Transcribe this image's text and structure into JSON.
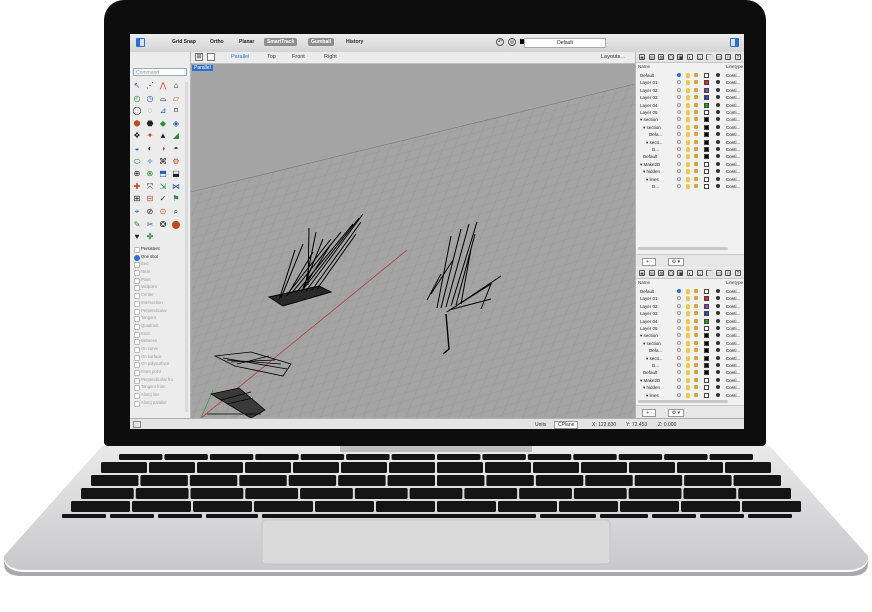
{
  "toolbar": {
    "items": [
      "Grid Snap",
      "Ortho",
      "Planar",
      "SmartTrack",
      "Gumball",
      "History"
    ],
    "active": [
      "SmartTrack",
      "Gumball"
    ],
    "layer_value": "Default"
  },
  "command": {
    "placeholder": "Command"
  },
  "viewport_tabs": {
    "items": [
      "Parallel",
      "Top",
      "Front",
      "Right"
    ],
    "active": "Parallel",
    "layouts": "Layouts..."
  },
  "viewport": {
    "label": "Parallel"
  },
  "snaps": {
    "persistent": "Persistent",
    "one_shot": "One shot",
    "items": [
      "End",
      "Near",
      "Point",
      "Midpoint",
      "Center",
      "Intersection",
      "Perpendicular",
      "Tangent",
      "Quadrant",
      "Knot",
      "Between",
      "On curve",
      "On surface",
      "On polysurface",
      "From point",
      "Perpendicular fro",
      "Tangent from",
      "Along line",
      "Along parallel"
    ]
  },
  "layers": {
    "header_name": "Name",
    "header_linetype": "Linetype",
    "linetype_value": "Conti...",
    "rows": [
      {
        "name": "Default",
        "indent": 0,
        "current": true,
        "color": "#ffffff"
      },
      {
        "name": "Layer 01",
        "indent": 0,
        "color": "#e0262b"
      },
      {
        "name": "Layer 02",
        "indent": 0,
        "color": "#8a3fc2"
      },
      {
        "name": "Layer 03",
        "indent": 0,
        "color": "#2846c9"
      },
      {
        "name": "Layer 04",
        "indent": 0,
        "color": "#1f9e2c"
      },
      {
        "name": "Layer 05",
        "indent": 0,
        "color": "#ffffff"
      },
      {
        "name": "▾ section",
        "indent": 0,
        "color": "#000000"
      },
      {
        "name": "▾ section",
        "indent": 1,
        "color": "#000000"
      },
      {
        "name": "Defa...",
        "indent": 3,
        "color": "#000000"
      },
      {
        "name": "▾ secti...",
        "indent": 2,
        "color": "#000000"
      },
      {
        "name": "D...",
        "indent": 4,
        "color": "#000000"
      },
      {
        "name": "Default",
        "indent": 1,
        "color": "#000000"
      },
      {
        "name": "▾ Make2D",
        "indent": 0,
        "color": "#ffffff"
      },
      {
        "name": "▾ hidden",
        "indent": 1,
        "color": "#ffffff"
      },
      {
        "name": "▾ lines",
        "indent": 2,
        "color": "#ffffff"
      },
      {
        "name": "D...",
        "indent": 4,
        "color": "#ffffff"
      }
    ],
    "plus": "+ ·",
    "gear": "⚙ ▾"
  },
  "status": {
    "units": "Units",
    "cplane": "CPlane",
    "x": "X: 122.830",
    "y": "Y: 72.453",
    "z": "Z: 0.000"
  }
}
